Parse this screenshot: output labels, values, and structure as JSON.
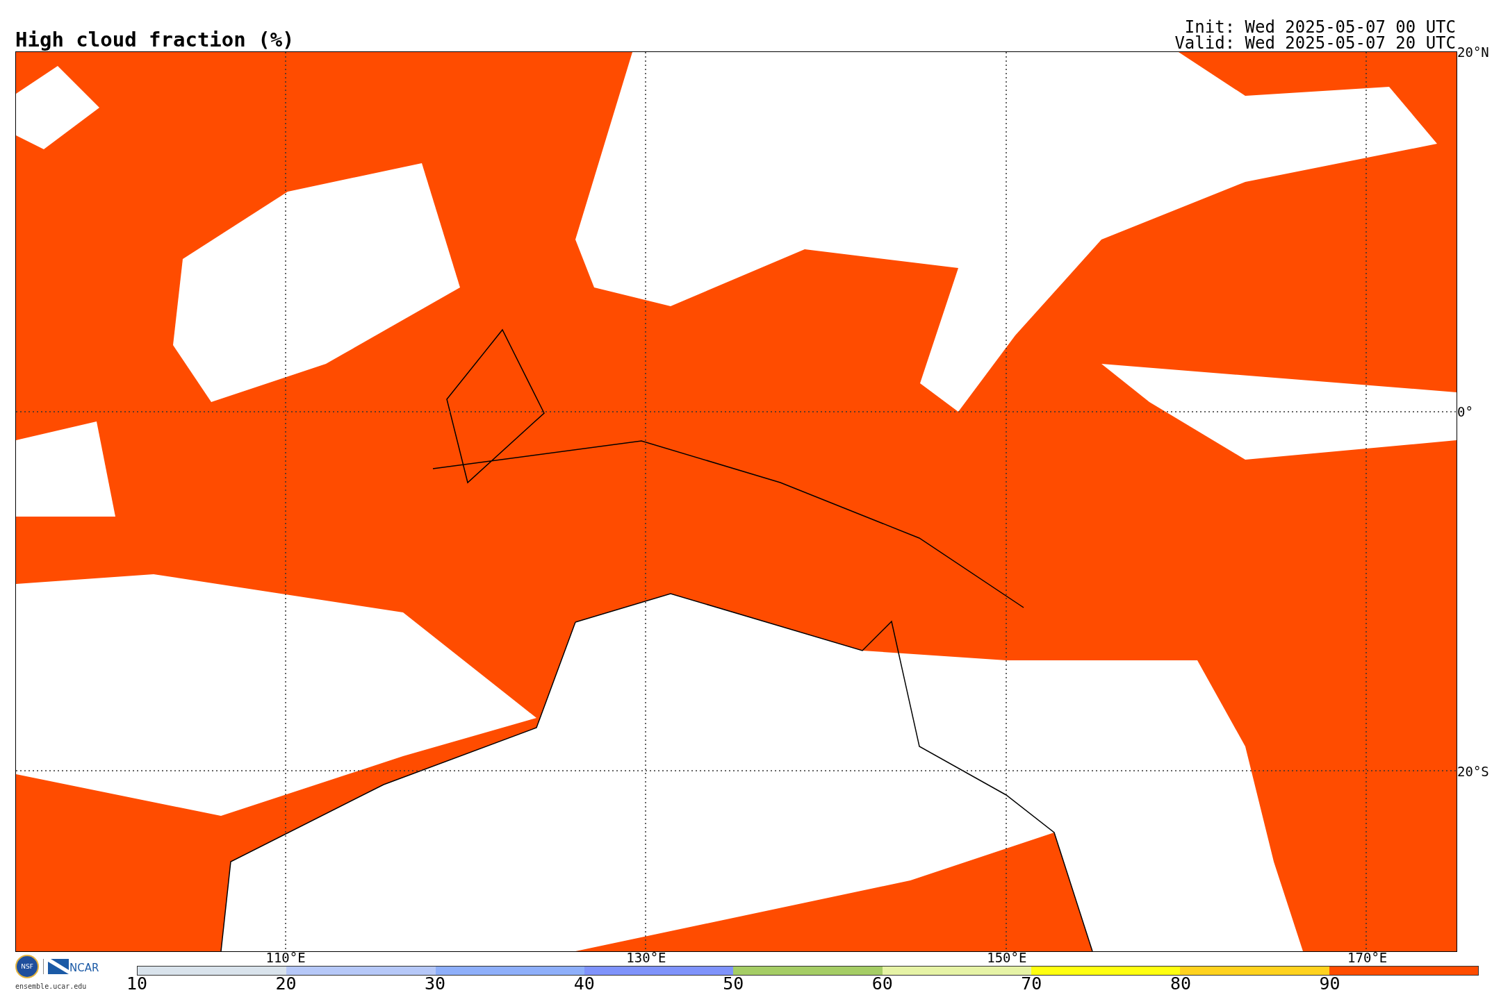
{
  "title": "High cloud fraction (%)",
  "run_info": {
    "init": "Init: Wed 2025-05-07 00 UTC",
    "valid": "Valid: Wed 2025-05-07 20 UTC"
  },
  "map": {
    "longitude_labels": [
      "110°E",
      "130°E",
      "150°E",
      "170°E"
    ],
    "latitude_labels": [
      "20°N",
      "0°",
      "20°S"
    ]
  },
  "logo": {
    "seal": "NSF",
    "name": "NCAR",
    "url": "ensemble.ucar.edu"
  },
  "colorbar": {
    "bins": [
      {
        "color": "#d9e3ec"
      },
      {
        "color": "#b6c8f8"
      },
      {
        "color": "#8eaffa"
      },
      {
        "color": "#7f93fb"
      },
      {
        "color": "#a5cd65"
      },
      {
        "color": "#e6f3a6"
      },
      {
        "color": "#ffff10"
      },
      {
        "color": "#ffd21e"
      },
      {
        "color": "#ff4c00"
      }
    ],
    "tick_labels": [
      "10",
      "20",
      "30",
      "40",
      "50",
      "60",
      "70",
      "80",
      "90"
    ]
  }
}
